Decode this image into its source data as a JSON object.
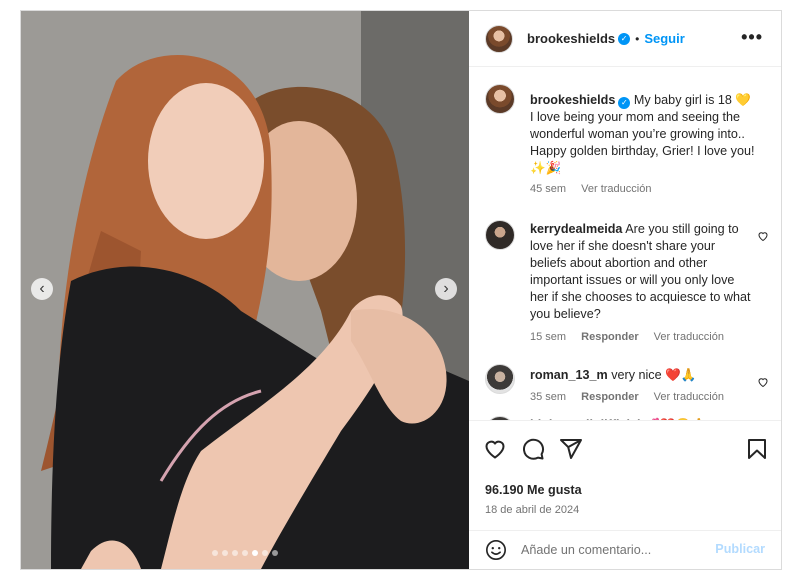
{
  "post": {
    "username": "brookeshields",
    "follow_label": "Seguir",
    "more_icon": "more-horizontal-icon",
    "verified_icon": "verified-badge-icon"
  },
  "carousel": {
    "prev_icon": "chevron-left-icon",
    "next_icon": "chevron-right-icon",
    "slides_total": 7,
    "active_slide": 5
  },
  "caption": {
    "username": "brookeshields",
    "text": "My baby girl is 18 💛 I love being your mom and seeing the wonderful woman you’re growing into.. Happy golden birthday, Grier! I love you! ✨🎉",
    "time": "45 sem",
    "translate": "Ver traducción"
  },
  "comments": [
    {
      "username": "kerrydealmeida",
      "text": "Are you still going to love her if she doesn't share your beliefs about abortion and other important issues or will you only love her if she chooses to acquiesce to what you believe?",
      "time": "15 sem",
      "reply": "Responder",
      "translate": "Ver traducción"
    },
    {
      "username": "roman_13_m",
      "text": "very nice ❤️🙏",
      "time": "35 sem",
      "reply": "Responder",
      "translate": "Ver traducción"
    },
    {
      "username": "bigbengallolifficial",
      "text": "💕❤️🙂🙏"
    }
  ],
  "actions": {
    "like_icon": "heart-icon",
    "comment_icon": "comment-icon",
    "share_icon": "share-icon",
    "save_icon": "bookmark-icon"
  },
  "likes_text": "96.190 Me gusta",
  "date_text": "18 de abril de 2024",
  "add_comment": {
    "placeholder": "Añade un comentario...",
    "publish_label": "Publicar",
    "emoji_icon": "smiley-icon"
  },
  "colors": {
    "accent": "#0095f6",
    "publish_disabled": "#b3dbff",
    "muted_text": "#737373",
    "text": "#262626"
  }
}
